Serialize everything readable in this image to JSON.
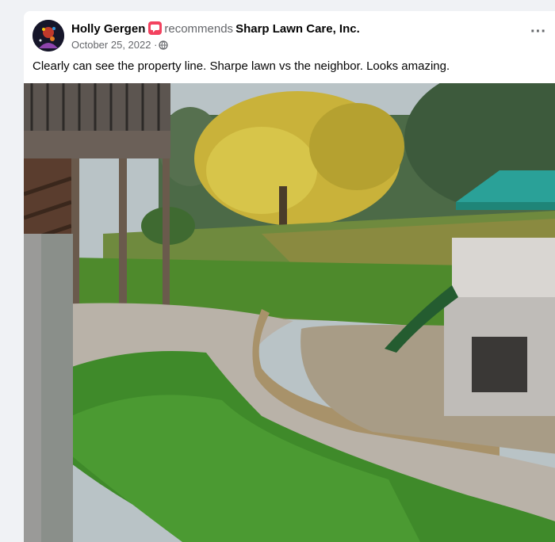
{
  "post": {
    "author": "Holly Gergen",
    "action": "recommends",
    "page": "Sharp Lawn Care, Inc.",
    "date": "October 25, 2022",
    "separator": "·",
    "text": "Clearly can see the property line. Sharpe lawn vs the neighbor. Looks amazing.",
    "more_label": "···"
  },
  "icons": {
    "avatar": "profile-avatar",
    "recommend": "recommend-badge-icon",
    "audience": "globe-icon",
    "more": "more-options-icon"
  },
  "colors": {
    "page_background": "#f0f2f5",
    "card_background": "#ffffff",
    "primary_text": "#050505",
    "secondary_text": "#65676b",
    "recommend_badge": "#f3425f",
    "playset_roof": "#2aa198"
  }
}
